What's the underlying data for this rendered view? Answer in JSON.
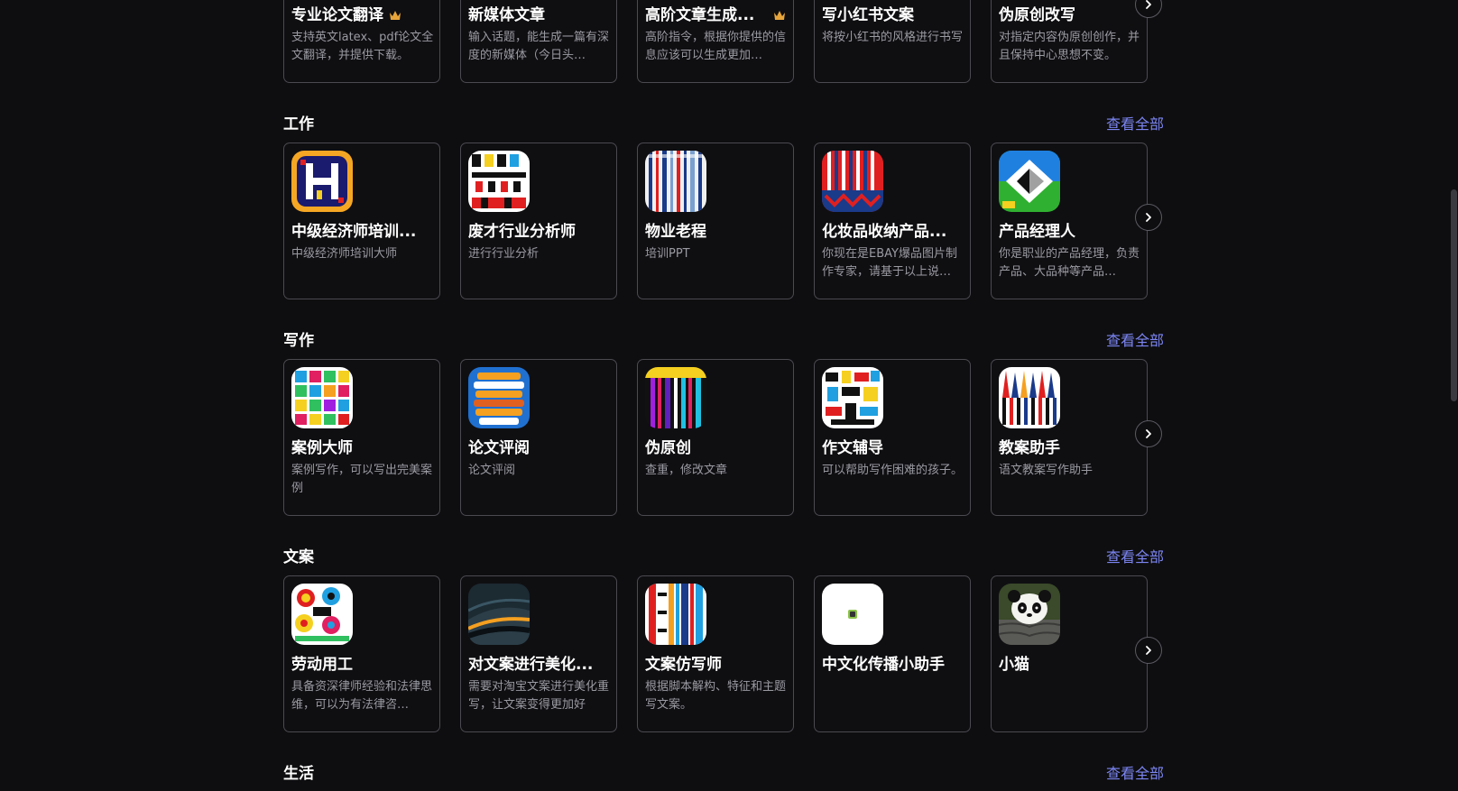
{
  "top_row": {
    "cards": [
      {
        "name": "专业论文翻译",
        "desc": "支持英文latex、pdf论文全文翻译，并提供下载。",
        "premium": true
      },
      {
        "name": "新媒体文章",
        "desc": "输入话题，能生成一篇有深度的新媒体（今日头…",
        "premium": false
      },
      {
        "name": "高阶文章生成...",
        "desc": "高阶指令，根据你提供的信息应该可以生成更加…",
        "premium": true
      },
      {
        "name": "写小红书文案",
        "desc": "将按小红书的风格进行书写",
        "premium": false
      },
      {
        "name": "伪原创改写",
        "desc": "对指定内容伪原创创作，并且保持中心思想不变。",
        "premium": false
      }
    ]
  },
  "sections": [
    {
      "title": "工作",
      "view_all": "查看全部",
      "cards": [
        {
          "name": "中级经济师培训...",
          "desc": "中级经济师培训大师",
          "icon": "pixel-art-h-icon"
        },
        {
          "name": "废才行业分析师",
          "desc": "进行行业分析",
          "icon": "pixel-art-blocks-icon"
        },
        {
          "name": "物业老程",
          "desc": "培训PPT",
          "icon": "striped-pattern-icon"
        },
        {
          "name": "化妆品收纳产品...",
          "desc": "你现在是EBAY爆品图片制作专家，请基于以上说…",
          "icon": "red-stripes-icon"
        },
        {
          "name": "产品经理人",
          "desc": "你是职业的产品经理，负责产品、大品种等产品…",
          "icon": "geometric-logo-icon"
        }
      ]
    },
    {
      "title": "写作",
      "view_all": "查看全部",
      "cards": [
        {
          "name": "案例大师",
          "desc": "案例写作，可以写出完美案例",
          "icon": "color-grid-icon"
        },
        {
          "name": "论文评阅",
          "desc": "论文评阅",
          "icon": "stacked-layers-icon"
        },
        {
          "name": "伪原创",
          "desc": "查重，修改文章",
          "icon": "vertical-bars-icon"
        },
        {
          "name": "作文辅导",
          "desc": "可以帮助写作困难的孩子。",
          "icon": "glitch-pattern-icon"
        },
        {
          "name": "教案助手",
          "desc": "语文教案写作助手",
          "icon": "spikes-pattern-icon"
        }
      ]
    },
    {
      "title": "文案",
      "view_all": "查看全部",
      "cards": [
        {
          "name": "劳动用工",
          "desc": "具备资深律师经验和法律思维，可以为有法律咨…",
          "icon": "mosaic-pattern-icon"
        },
        {
          "name": "对文案进行美化...",
          "desc": "需要对淘宝文案进行美化重写，让文案变得更加好",
          "icon": "curved-lines-icon"
        },
        {
          "name": "文案仿写师",
          "desc": "根据脚本解构、特征和主题写文案。",
          "icon": "colored-columns-icon"
        },
        {
          "name": "中文化传播小助手",
          "desc": "",
          "icon": "small-square-logo-icon"
        },
        {
          "name": "小猫",
          "desc": "",
          "icon": "panda-icon"
        }
      ]
    },
    {
      "title": "生活",
      "view_all": "查看全部",
      "cards": []
    }
  ],
  "colors": {
    "background": "#0e0e10",
    "card_border": "#4a4a50",
    "link": "#7c85f2",
    "desc_text": "#9a9aa2",
    "crown": "#e8a53a"
  }
}
